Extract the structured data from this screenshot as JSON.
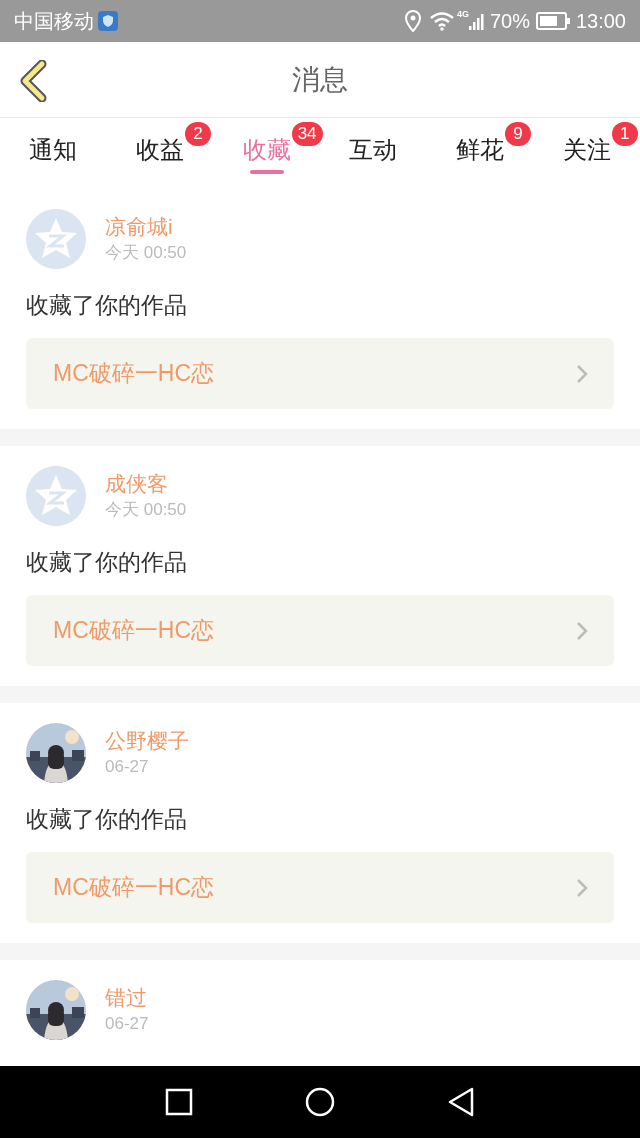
{
  "status_bar": {
    "carrier": "中国移动",
    "network": "4G",
    "battery": "70%",
    "time": "13:00"
  },
  "header": {
    "title": "消息"
  },
  "tabs": [
    {
      "label": "通知",
      "selected": false
    },
    {
      "label": "收益",
      "selected": false,
      "badge": "2"
    },
    {
      "label": "收藏",
      "selected": true,
      "badge": "34"
    },
    {
      "label": "互动",
      "selected": false
    },
    {
      "label": "鲜花",
      "selected": false,
      "badge": "9"
    },
    {
      "label": "关注",
      "selected": false,
      "badge": "1"
    }
  ],
  "messages": [
    {
      "name": "凉俞城i",
      "time": "今天 00:50",
      "avatar": {
        "kind": "default"
      },
      "text": "收藏了你的作品",
      "work": "MC破碎一HC恋"
    },
    {
      "name": "成侠客",
      "time": "今天 00:50",
      "avatar": {
        "kind": "default"
      },
      "text": "收藏了你的作品",
      "work": "MC破碎一HC恋"
    },
    {
      "name": "公野樱子",
      "time": "06-27",
      "text": "收藏了你的作品",
      "work": "MC破碎一HC恋"
    },
    {
      "name": "错过",
      "time": "06-27"
    }
  ]
}
